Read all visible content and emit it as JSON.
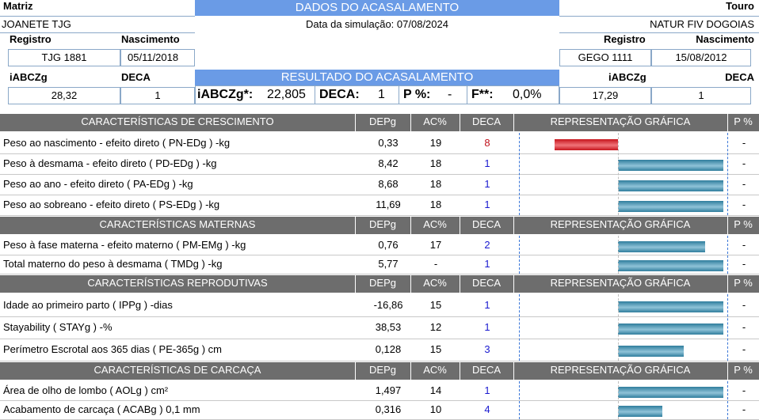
{
  "header": {
    "matriz_label": "Matriz",
    "title": "DADOS DO ACASALAMENTO",
    "touro_label": "Touro",
    "matriz_name": "JOANETE TJG",
    "sim_date": "Data da simulação: 07/08/2024",
    "touro_name": "NATUR FIV DOGOIAS",
    "registro_label": "Registro",
    "nascimento_label": "Nascimento",
    "matriz_registro": "TJG 1881",
    "matriz_nascimento": "05/11/2018",
    "touro_registro": "GEGO 1111",
    "touro_nascimento": "15/08/2012",
    "iabczg_label": "iABCZg",
    "deca_label": "DECA",
    "result_title": "RESULTADO DO ACASALAMENTO",
    "matriz_iabczg": "28,32",
    "matriz_deca": "1",
    "touro_iabczg": "17,29",
    "touro_deca": "1",
    "result": {
      "iabczg_label": "iABCZg*:",
      "iabczg_value": "22,805",
      "deca_label": "DECA:",
      "deca_value": "1",
      "p_label": "P %:",
      "p_value": "-",
      "f_label": "F**:",
      "f_value": "0,0%"
    }
  },
  "columns": {
    "depg": "DEPg",
    "ac": "AC%",
    "deca": "DECA",
    "rep": "REPRESENTAÇÃO GRÁFICA",
    "p": "P %"
  },
  "colors": {
    "banner": "#6a9be6",
    "section": "#6d6d6d",
    "deca_red": "#c0101a",
    "deca_blue": "#1a1ad0",
    "bar_blue": "#2f7d9d",
    "bar_red": "#c6151d"
  },
  "sections": [
    {
      "title": "CARACTERÍSTICAS DE CRESCIMENTO",
      "rows": [
        {
          "name": "Peso ao nascimento - efeito direto ( PN-EDg ) -kg",
          "depg": "0,33",
          "ac": "19",
          "deca": "8",
          "p": "-",
          "bar_fraction": 0.5,
          "bar_color": "red"
        },
        {
          "name": "Peso à desmama - efeito direto ( PD-EDg ) -kg",
          "depg": "8,42",
          "ac": "18",
          "deca": "1",
          "p": "-",
          "bar_fraction": 0.99,
          "bar_color": "blue"
        },
        {
          "name": "Peso ao ano - efeito direto ( PA-EDg ) -kg",
          "depg": "8,68",
          "ac": "18",
          "deca": "1",
          "p": "-",
          "bar_fraction": 0.99,
          "bar_color": "blue"
        },
        {
          "name": "Peso ao sobreano - efeito direto ( PS-EDg ) -kg",
          "depg": "11,69",
          "ac": "18",
          "deca": "1",
          "p": "-",
          "bar_fraction": 0.99,
          "bar_color": "blue"
        }
      ]
    },
    {
      "title": "CARACTERÍSTICAS MATERNAS",
      "rows": [
        {
          "name": "Peso à fase materna - efeito materno ( PM-EMg ) -kg",
          "depg": "0,76",
          "ac": "17",
          "deca": "2",
          "p": "-",
          "bar_fraction": 0.82,
          "bar_color": "blue"
        },
        {
          "name": "Total materno do peso à desmama ( TMDg ) -kg",
          "depg": "5,77",
          "ac": "-",
          "deca": "1",
          "p": "-",
          "bar_fraction": 0.99,
          "bar_color": "blue"
        }
      ]
    },
    {
      "title": "CARACTERÍSTICAS REPRODUTIVAS",
      "rows": [
        {
          "name": "Idade ao primeiro parto ( IPPg ) -dias",
          "depg": "-16,86",
          "ac": "15",
          "deca": "1",
          "p": "-",
          "bar_fraction": 0.99,
          "bar_color": "blue"
        },
        {
          "name": "Stayability ( STAYg ) -%",
          "depg": "38,53",
          "ac": "12",
          "deca": "1",
          "p": "-",
          "bar_fraction": 0.99,
          "bar_color": "blue"
        },
        {
          "name": "Perímetro Escrotal aos 365 dias ( PE-365g ) cm",
          "depg": "0,128",
          "ac": "15",
          "deca": "3",
          "p": "-",
          "bar_fraction": 0.62,
          "bar_color": "blue"
        }
      ]
    },
    {
      "title": "CARACTERÍSTICAS DE CARCAÇA",
      "rows": [
        {
          "name": "Área de olho de lombo ( AOLg ) cm²",
          "depg": "1,497",
          "ac": "14",
          "deca": "1",
          "p": "-",
          "bar_fraction": 0.99,
          "bar_color": "blue"
        },
        {
          "name": "Acabamento de carcaça ( ACABg ) 0,1 mm",
          "depg": "0,316",
          "ac": "10",
          "deca": "4",
          "p": "-",
          "bar_fraction": 0.42,
          "bar_color": "blue"
        }
      ]
    }
  ]
}
